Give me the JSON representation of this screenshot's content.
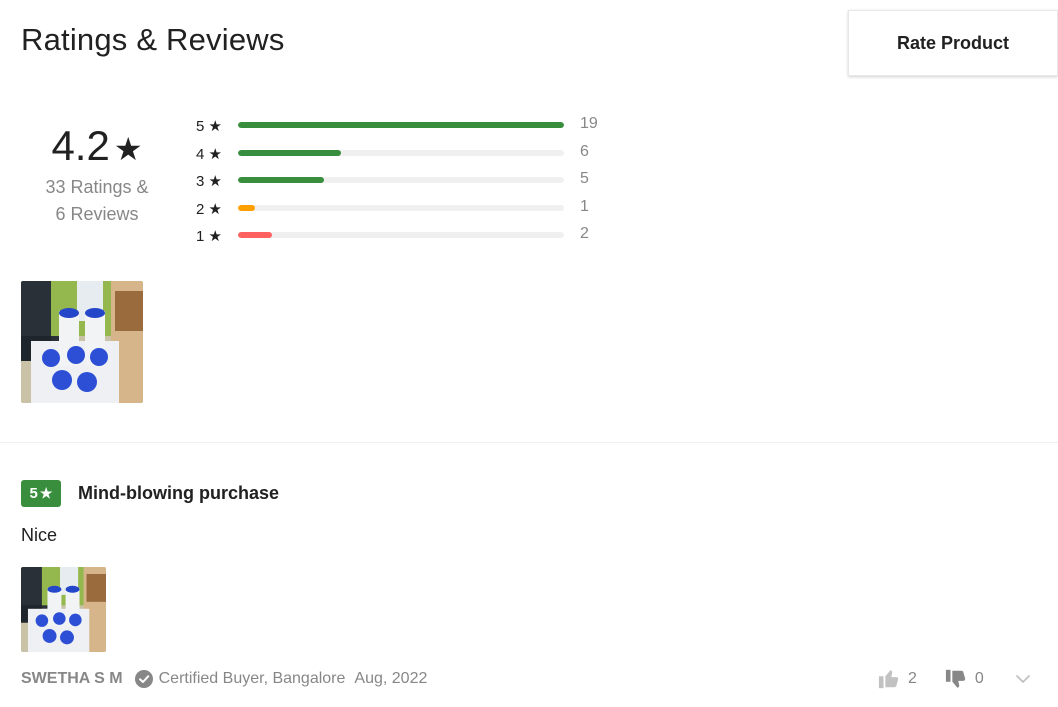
{
  "header": {
    "title": "Ratings & Reviews",
    "rate_button": "Rate Product"
  },
  "summary": {
    "average": "4.2",
    "star": "★",
    "ratings_text": "33 Ratings &",
    "reviews_text": "6 Reviews"
  },
  "distribution": [
    {
      "label": "5 ★",
      "count": "19",
      "fraction": 1.0,
      "color": "#388e3c"
    },
    {
      "label": "4 ★",
      "count": "6",
      "fraction": 0.316,
      "color": "#388e3c"
    },
    {
      "label": "3 ★",
      "count": "5",
      "fraction": 0.263,
      "color": "#388e3c"
    },
    {
      "label": "2 ★",
      "count": "1",
      "fraction": 0.053,
      "color": "#ff9f00"
    },
    {
      "label": "1 ★",
      "count": "2",
      "fraction": 0.105,
      "color": "#ff6161"
    }
  ],
  "review": {
    "rating": "5",
    "star": "★",
    "title": "Mind-blowing purchase",
    "body": "Nice",
    "author": "SWETHA S M",
    "certified": "Certified Buyer, Bangalore",
    "date": "Aug, 2022",
    "likes": "2",
    "dislikes": "0"
  },
  "icons": {
    "certified": "check-circle-icon",
    "like": "thumbs-up-icon",
    "dislike": "thumbs-down-icon",
    "expand": "chevron-down-icon"
  }
}
